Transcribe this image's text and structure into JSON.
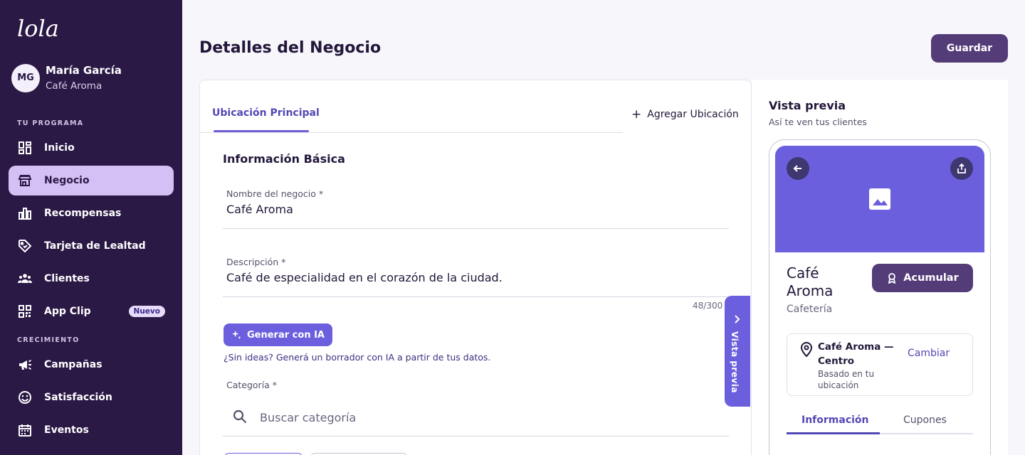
{
  "brand": {
    "logo_text": "lola"
  },
  "user": {
    "initials": "MG",
    "name": "María García",
    "business": "Café Aroma"
  },
  "sidebar": {
    "sections": [
      {
        "label": "TU PROGRAMA"
      },
      {
        "label": "CRECIMIENTO"
      }
    ],
    "items": [
      {
        "label": "Inicio",
        "icon": "dashboard-icon"
      },
      {
        "label": "Negocio",
        "icon": "store-icon",
        "active": true
      },
      {
        "label": "Recompensas",
        "icon": "bar-chart-icon"
      },
      {
        "label": "Tarjeta de Lealtad",
        "icon": "tag-icon"
      },
      {
        "label": "Clientes",
        "icon": "people-icon"
      },
      {
        "label": "App Clip",
        "icon": "qr-code-icon",
        "badge": "Nuevo"
      },
      {
        "label": "Campañas",
        "icon": "megaphone-icon"
      },
      {
        "label": "Satisfacción",
        "icon": "smiley-icon"
      },
      {
        "label": "Eventos",
        "icon": "calendar-icon"
      }
    ]
  },
  "header": {
    "title": "Detalles del Negocio",
    "save_label": "Guardar"
  },
  "form": {
    "tab_main": "Ubicación Principal",
    "add_location": "Agregar Ubicación",
    "section_title": "Información Básica",
    "name_label": "Nombre del negocio *",
    "name_value": "Café Aroma",
    "description_label": "Descripción *",
    "description_value": "Café de especialidad en el corazón de la ciudad.",
    "description_counter": "48/300",
    "ai_button": "Generar con IA",
    "ai_hint": "¿Sin ideas? Generá un borrador con IA a partir de tus datos.",
    "category_label": "Categoría *",
    "category_placeholder": "Buscar categoría",
    "preview_toggle": "Vista previa"
  },
  "preview": {
    "title": "Vista previa",
    "subtitle": "Así te ven tus clientes",
    "business_name": "Café Aroma",
    "business_category": "Cafetería",
    "accumulate_button": "Acumular",
    "location_name": "Café Aroma — Centro",
    "location_sub": "Basado en tu ubicación",
    "change_label": "Cambiar",
    "tabs": [
      "Información",
      "Cupones"
    ]
  },
  "colors": {
    "sidebar_bg": "#2a1845",
    "active_nav": "#d4c0f5",
    "primary_dark": "#533c78",
    "accent": "#6b5fde"
  }
}
